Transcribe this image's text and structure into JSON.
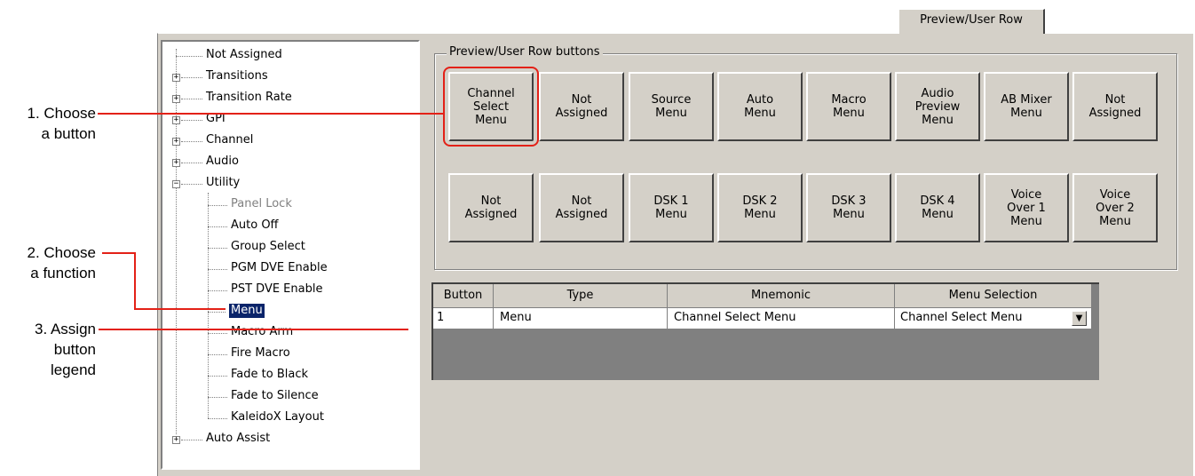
{
  "tab": {
    "label": "Preview/User Row"
  },
  "tree": {
    "items": [
      {
        "label": "Not Assigned",
        "expandable": false,
        "state": ""
      },
      {
        "label": "Transitions",
        "expandable": true,
        "state": "+"
      },
      {
        "label": "Transition Rate",
        "expandable": true,
        "state": "+"
      },
      {
        "label": "GPI",
        "expandable": true,
        "state": "+"
      },
      {
        "label": "Channel",
        "expandable": true,
        "state": "+"
      },
      {
        "label": "Audio",
        "expandable": true,
        "state": "+"
      },
      {
        "label": "Utility",
        "expandable": true,
        "state": "−"
      },
      {
        "label": "Panel Lock",
        "child": true,
        "disabled": true
      },
      {
        "label": "Auto Off",
        "child": true
      },
      {
        "label": "Group Select",
        "child": true
      },
      {
        "label": "PGM DVE Enable",
        "child": true
      },
      {
        "label": "PST DVE Enable",
        "child": true
      },
      {
        "label": "Menu",
        "child": true,
        "selected": true
      },
      {
        "label": "Macro Arm",
        "child": true
      },
      {
        "label": "Fire Macro",
        "child": true
      },
      {
        "label": "Fade to Black",
        "child": true
      },
      {
        "label": "Fade to Silence",
        "child": true
      },
      {
        "label": "KaleidoX Layout",
        "child": true
      },
      {
        "label": "Auto Assist",
        "expandable": true,
        "state": "+"
      }
    ]
  },
  "buttons_group": {
    "title": "Preview/User Row buttons",
    "row1": [
      "Channel\nSelect\nMenu",
      "Not\nAssigned",
      "Source\nMenu",
      "Auto\nMenu",
      "Macro\nMenu",
      "Audio\nPreview\nMenu",
      "AB Mixer\nMenu",
      "Not\nAssigned"
    ],
    "row2": [
      "Not\nAssigned",
      "Not\nAssigned",
      "DSK 1\nMenu",
      "DSK 2\nMenu",
      "DSK 3\nMenu",
      "DSK 4\nMenu",
      "Voice\nOver 1\nMenu",
      "Voice\nOver 2\nMenu"
    ]
  },
  "grid": {
    "headers": [
      "Button",
      "Type",
      "Mnemonic",
      "Menu Selection"
    ],
    "row": {
      "button": "1",
      "type": "Menu",
      "mnemonic": "Channel Select Menu",
      "menu_selection": "Channel Select Menu"
    }
  },
  "annotations": {
    "step1": "1. Choose\na button",
    "step2": "2. Choose\na function",
    "step3": "3. Assign\nbutton\nlegend",
    "line_color": "#e32117"
  }
}
